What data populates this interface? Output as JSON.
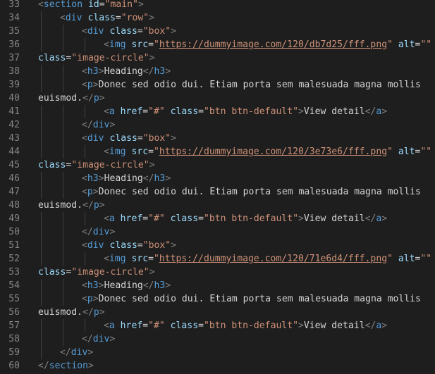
{
  "editor": {
    "theme_colors": {
      "background": "#1e1e1e",
      "line_number": "#858585",
      "tag": "#569cd6",
      "punctuation": "#808080",
      "attribute": "#9cdcfe",
      "string": "#ce9178",
      "text": "#d4d4d4",
      "indent_guide": "#404040"
    },
    "lines": [
      {
        "number": "33",
        "indent": 0,
        "tokens": [
          {
            "k": "p",
            "v": "<"
          },
          {
            "k": "tag",
            "v": "section"
          },
          {
            "k": "text",
            "v": " "
          },
          {
            "k": "attr",
            "v": "id"
          },
          {
            "k": "text",
            "v": "="
          },
          {
            "k": "str",
            "v": "\"main\""
          },
          {
            "k": "p",
            "v": ">"
          }
        ]
      },
      {
        "number": "34",
        "indent": 1,
        "tokens": [
          {
            "k": "p",
            "v": "<"
          },
          {
            "k": "tag",
            "v": "div"
          },
          {
            "k": "text",
            "v": " "
          },
          {
            "k": "attr",
            "v": "class"
          },
          {
            "k": "text",
            "v": "="
          },
          {
            "k": "str",
            "v": "\"row\""
          },
          {
            "k": "p",
            "v": ">"
          }
        ]
      },
      {
        "number": "35",
        "indent": 2,
        "tokens": [
          {
            "k": "p",
            "v": "<"
          },
          {
            "k": "tag",
            "v": "div"
          },
          {
            "k": "text",
            "v": " "
          },
          {
            "k": "attr",
            "v": "class"
          },
          {
            "k": "text",
            "v": "="
          },
          {
            "k": "str",
            "v": "\"box\""
          },
          {
            "k": "p",
            "v": ">"
          }
        ]
      },
      {
        "number": "36",
        "indent": 3,
        "tokens": [
          {
            "k": "p",
            "v": "<"
          },
          {
            "k": "tag",
            "v": "img"
          },
          {
            "k": "text",
            "v": " "
          },
          {
            "k": "attr",
            "v": "src"
          },
          {
            "k": "text",
            "v": "="
          },
          {
            "k": "str",
            "v": "\""
          },
          {
            "k": "link",
            "v": "https://dummyimage.com/120/db7d25/fff.png"
          },
          {
            "k": "str",
            "v": "\""
          },
          {
            "k": "text",
            "v": " "
          },
          {
            "k": "attr",
            "v": "alt"
          },
          {
            "k": "text",
            "v": "="
          },
          {
            "k": "str",
            "v": "\"\""
          }
        ]
      },
      {
        "number": "37",
        "indent": 0,
        "tokens": [
          {
            "k": "attr",
            "v": "class"
          },
          {
            "k": "text",
            "v": "="
          },
          {
            "k": "str",
            "v": "\"image-circle\""
          },
          {
            "k": "p",
            "v": ">"
          }
        ]
      },
      {
        "number": "38",
        "indent": 2,
        "tokens": [
          {
            "k": "p",
            "v": "<"
          },
          {
            "k": "tag",
            "v": "h3"
          },
          {
            "k": "p",
            "v": ">"
          },
          {
            "k": "text",
            "v": "Heading"
          },
          {
            "k": "p",
            "v": "</"
          },
          {
            "k": "tag",
            "v": "h3"
          },
          {
            "k": "p",
            "v": ">"
          }
        ]
      },
      {
        "number": "39",
        "indent": 2,
        "tokens": [
          {
            "k": "p",
            "v": "<"
          },
          {
            "k": "tag",
            "v": "p"
          },
          {
            "k": "p",
            "v": ">"
          },
          {
            "k": "text",
            "v": "Donec sed odio dui. Etiam porta sem malesuada magna mollis"
          }
        ]
      },
      {
        "number": "40",
        "indent": 0,
        "tokens": [
          {
            "k": "text",
            "v": "euismod."
          },
          {
            "k": "p",
            "v": "</"
          },
          {
            "k": "tag",
            "v": "p"
          },
          {
            "k": "p",
            "v": ">"
          }
        ]
      },
      {
        "number": "41",
        "indent": 3,
        "tokens": [
          {
            "k": "p",
            "v": "<"
          },
          {
            "k": "tag",
            "v": "a"
          },
          {
            "k": "text",
            "v": " "
          },
          {
            "k": "attr",
            "v": "href"
          },
          {
            "k": "text",
            "v": "="
          },
          {
            "k": "str",
            "v": "\"#\""
          },
          {
            "k": "text",
            "v": " "
          },
          {
            "k": "attr",
            "v": "class"
          },
          {
            "k": "text",
            "v": "="
          },
          {
            "k": "str",
            "v": "\"btn btn-default\""
          },
          {
            "k": "p",
            "v": ">"
          },
          {
            "k": "text",
            "v": "View detail"
          },
          {
            "k": "p",
            "v": "</"
          },
          {
            "k": "tag",
            "v": "a"
          },
          {
            "k": "p",
            "v": ">"
          }
        ]
      },
      {
        "number": "42",
        "indent": 2,
        "tokens": [
          {
            "k": "p",
            "v": "</"
          },
          {
            "k": "tag",
            "v": "div"
          },
          {
            "k": "p",
            "v": ">"
          }
        ]
      },
      {
        "number": "43",
        "indent": 2,
        "tokens": [
          {
            "k": "p",
            "v": "<"
          },
          {
            "k": "tag",
            "v": "div"
          },
          {
            "k": "text",
            "v": " "
          },
          {
            "k": "attr",
            "v": "class"
          },
          {
            "k": "text",
            "v": "="
          },
          {
            "k": "str",
            "v": "\"box\""
          },
          {
            "k": "p",
            "v": ">"
          }
        ]
      },
      {
        "number": "44",
        "indent": 3,
        "tokens": [
          {
            "k": "p",
            "v": "<"
          },
          {
            "k": "tag",
            "v": "img"
          },
          {
            "k": "text",
            "v": " "
          },
          {
            "k": "attr",
            "v": "src"
          },
          {
            "k": "text",
            "v": "="
          },
          {
            "k": "str",
            "v": "\""
          },
          {
            "k": "link",
            "v": "https://dummyimage.com/120/3e73e6/fff.png"
          },
          {
            "k": "str",
            "v": "\""
          },
          {
            "k": "text",
            "v": " "
          },
          {
            "k": "attr",
            "v": "alt"
          },
          {
            "k": "text",
            "v": "="
          },
          {
            "k": "str",
            "v": "\"\""
          }
        ]
      },
      {
        "number": "45",
        "indent": 0,
        "tokens": [
          {
            "k": "attr",
            "v": "class"
          },
          {
            "k": "text",
            "v": "="
          },
          {
            "k": "str",
            "v": "\"image-circle\""
          },
          {
            "k": "p",
            "v": ">"
          }
        ]
      },
      {
        "number": "46",
        "indent": 2,
        "tokens": [
          {
            "k": "p",
            "v": "<"
          },
          {
            "k": "tag",
            "v": "h3"
          },
          {
            "k": "p",
            "v": ">"
          },
          {
            "k": "text",
            "v": "Heading"
          },
          {
            "k": "p",
            "v": "</"
          },
          {
            "k": "tag",
            "v": "h3"
          },
          {
            "k": "p",
            "v": ">"
          }
        ]
      },
      {
        "number": "47",
        "indent": 2,
        "tokens": [
          {
            "k": "p",
            "v": "<"
          },
          {
            "k": "tag",
            "v": "p"
          },
          {
            "k": "p",
            "v": ">"
          },
          {
            "k": "text",
            "v": "Donec sed odio dui. Etiam porta sem malesuada magna mollis"
          }
        ]
      },
      {
        "number": "48",
        "indent": 0,
        "tokens": [
          {
            "k": "text",
            "v": "euismod."
          },
          {
            "k": "p",
            "v": "</"
          },
          {
            "k": "tag",
            "v": "p"
          },
          {
            "k": "p",
            "v": ">"
          }
        ]
      },
      {
        "number": "49",
        "indent": 3,
        "tokens": [
          {
            "k": "p",
            "v": "<"
          },
          {
            "k": "tag",
            "v": "a"
          },
          {
            "k": "text",
            "v": " "
          },
          {
            "k": "attr",
            "v": "href"
          },
          {
            "k": "text",
            "v": "="
          },
          {
            "k": "str",
            "v": "\"#\""
          },
          {
            "k": "text",
            "v": " "
          },
          {
            "k": "attr",
            "v": "class"
          },
          {
            "k": "text",
            "v": "="
          },
          {
            "k": "str",
            "v": "\"btn btn-default\""
          },
          {
            "k": "p",
            "v": ">"
          },
          {
            "k": "text",
            "v": "View detail"
          },
          {
            "k": "p",
            "v": "</"
          },
          {
            "k": "tag",
            "v": "a"
          },
          {
            "k": "p",
            "v": ">"
          }
        ]
      },
      {
        "number": "50",
        "indent": 2,
        "tokens": [
          {
            "k": "p",
            "v": "</"
          },
          {
            "k": "tag",
            "v": "div"
          },
          {
            "k": "p",
            "v": ">"
          }
        ]
      },
      {
        "number": "51",
        "indent": 2,
        "tokens": [
          {
            "k": "p",
            "v": "<"
          },
          {
            "k": "tag",
            "v": "div"
          },
          {
            "k": "text",
            "v": " "
          },
          {
            "k": "attr",
            "v": "class"
          },
          {
            "k": "text",
            "v": "="
          },
          {
            "k": "str",
            "v": "\"box\""
          },
          {
            "k": "p",
            "v": ">"
          }
        ]
      },
      {
        "number": "52",
        "indent": 3,
        "tokens": [
          {
            "k": "p",
            "v": "<"
          },
          {
            "k": "tag",
            "v": "img"
          },
          {
            "k": "text",
            "v": " "
          },
          {
            "k": "attr",
            "v": "src"
          },
          {
            "k": "text",
            "v": "="
          },
          {
            "k": "str",
            "v": "\""
          },
          {
            "k": "link",
            "v": "https://dummyimage.com/120/71e6d4/fff.png"
          },
          {
            "k": "str",
            "v": "\""
          },
          {
            "k": "text",
            "v": " "
          },
          {
            "k": "attr",
            "v": "alt"
          },
          {
            "k": "text",
            "v": "="
          },
          {
            "k": "str",
            "v": "\"\""
          }
        ]
      },
      {
        "number": "53",
        "indent": 0,
        "tokens": [
          {
            "k": "attr",
            "v": "class"
          },
          {
            "k": "text",
            "v": "="
          },
          {
            "k": "str",
            "v": "\"image-circle\""
          },
          {
            "k": "p",
            "v": ">"
          }
        ]
      },
      {
        "number": "54",
        "indent": 2,
        "tokens": [
          {
            "k": "p",
            "v": "<"
          },
          {
            "k": "tag",
            "v": "h3"
          },
          {
            "k": "p",
            "v": ">"
          },
          {
            "k": "text",
            "v": "Heading"
          },
          {
            "k": "p",
            "v": "</"
          },
          {
            "k": "tag",
            "v": "h3"
          },
          {
            "k": "p",
            "v": ">"
          }
        ]
      },
      {
        "number": "55",
        "indent": 2,
        "tokens": [
          {
            "k": "p",
            "v": "<"
          },
          {
            "k": "tag",
            "v": "p"
          },
          {
            "k": "p",
            "v": ">"
          },
          {
            "k": "text",
            "v": "Donec sed odio dui. Etiam porta sem malesuada magna mollis"
          }
        ]
      },
      {
        "number": "56",
        "indent": 0,
        "tokens": [
          {
            "k": "text",
            "v": "euismod."
          },
          {
            "k": "p",
            "v": "</"
          },
          {
            "k": "tag",
            "v": "p"
          },
          {
            "k": "p",
            "v": ">"
          }
        ]
      },
      {
        "number": "57",
        "indent": 3,
        "tokens": [
          {
            "k": "p",
            "v": "<"
          },
          {
            "k": "tag",
            "v": "a"
          },
          {
            "k": "text",
            "v": " "
          },
          {
            "k": "attr",
            "v": "href"
          },
          {
            "k": "text",
            "v": "="
          },
          {
            "k": "str",
            "v": "\"#\""
          },
          {
            "k": "text",
            "v": " "
          },
          {
            "k": "attr",
            "v": "class"
          },
          {
            "k": "text",
            "v": "="
          },
          {
            "k": "str",
            "v": "\"btn btn-default\""
          },
          {
            "k": "p",
            "v": ">"
          },
          {
            "k": "text",
            "v": "View detail"
          },
          {
            "k": "p",
            "v": "</"
          },
          {
            "k": "tag",
            "v": "a"
          },
          {
            "k": "p",
            "v": ">"
          }
        ]
      },
      {
        "number": "58",
        "indent": 2,
        "tokens": [
          {
            "k": "p",
            "v": "</"
          },
          {
            "k": "tag",
            "v": "div"
          },
          {
            "k": "p",
            "v": ">"
          }
        ]
      },
      {
        "number": "59",
        "indent": 1,
        "tokens": [
          {
            "k": "p",
            "v": "</"
          },
          {
            "k": "tag",
            "v": "div"
          },
          {
            "k": "p",
            "v": ">"
          }
        ]
      },
      {
        "number": "60",
        "indent": 0,
        "tokens": [
          {
            "k": "p",
            "v": "</"
          },
          {
            "k": "tag",
            "v": "section"
          },
          {
            "k": "p",
            "v": ">"
          }
        ]
      }
    ]
  }
}
